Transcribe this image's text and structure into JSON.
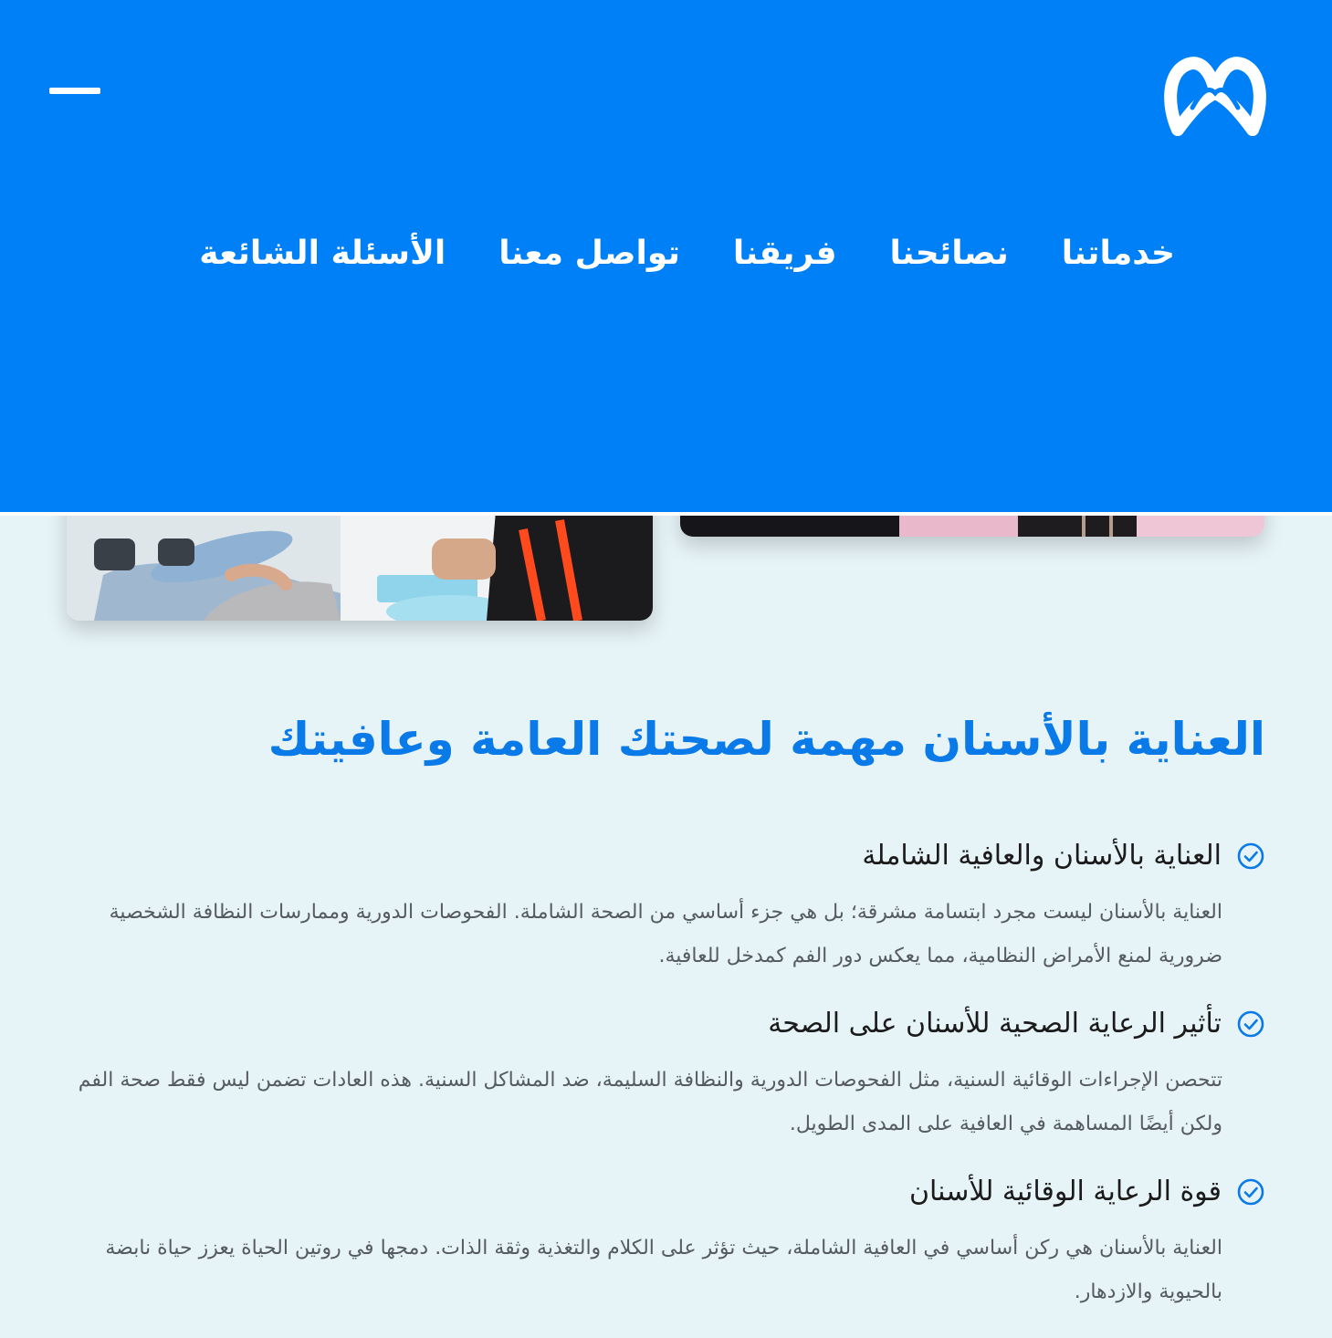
{
  "brand": {
    "logo_icon": "infinity-m-logo",
    "colors": {
      "primary": "#0080f6",
      "heading": "#0a7ae8",
      "background": "#e6f3f7",
      "text": "#555b60"
    }
  },
  "header": {
    "menu_icon": "hamburger-menu-icon",
    "nav": [
      {
        "label": "خدماتنا"
      },
      {
        "label": "نصائحنا"
      },
      {
        "label": "فريقنا"
      },
      {
        "label": "تواصل معنا"
      },
      {
        "label": "الأسئلة الشائعة"
      }
    ]
  },
  "main": {
    "heading": "العناية بالأسنان مهمة لصحتك العامة وعافيتك",
    "features": [
      {
        "icon": "check-circle-icon",
        "title": "العناية بالأسنان والعافية الشاملة",
        "text": "العناية بالأسنان ليست مجرد ابتسامة مشرقة؛ بل هي جزء أساسي من الصحة الشاملة. الفحوصات الدورية وممارسات النظافة الشخصية ضرورية لمنع الأمراض النظامية، مما يعكس دور الفم كمدخل للعافية."
      },
      {
        "icon": "check-circle-icon",
        "title": "تأثير الرعاية الصحية للأسنان على الصحة",
        "text": "تتحصن الإجراءات الوقائية السنية، مثل الفحوصات الدورية والنظافة السليمة، ضد المشاكل السنية. هذه العادات تضمن ليس فقط صحة الفم ولكن أيضًا المساهمة في العافية على المدى الطويل."
      },
      {
        "icon": "check-circle-icon",
        "title": "قوة الرعاية الوقائية للأسنان",
        "text": "العناية بالأسنان هي ركن أساسي في العافية الشاملة، حيث تؤثر على الكلام والتغذية وثقة الذات. دمجها في روتين الحياة يعزز حياة نابضة بالحيوية والازدهار."
      }
    ]
  }
}
